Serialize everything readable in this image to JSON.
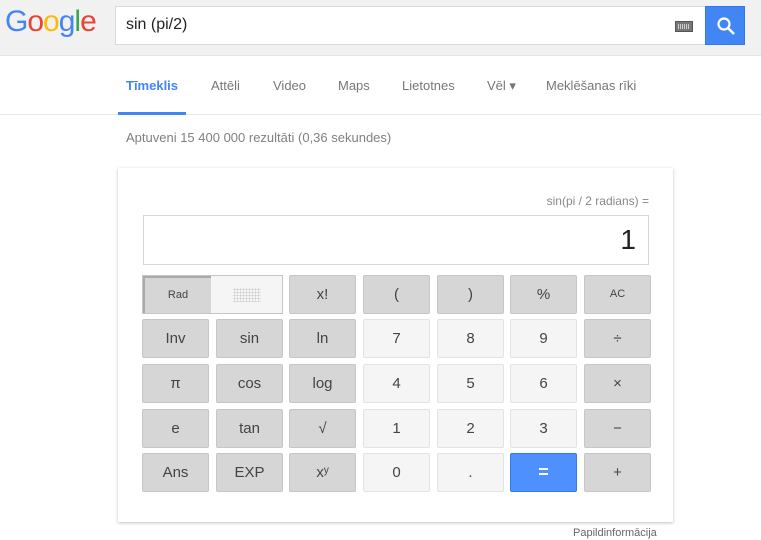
{
  "header": {
    "logo": "Google",
    "query": "sin (pi/2)",
    "keyboard_icon": "keyboard-icon",
    "search_icon": "search-icon",
    "accent": "#4285f4"
  },
  "nav": {
    "tabs": [
      {
        "label": "Tīmeklis",
        "active": true
      },
      {
        "label": "Attēli"
      },
      {
        "label": "Video"
      },
      {
        "label": "Maps"
      },
      {
        "label": "Lietotnes"
      },
      {
        "label": "Vēl ▾"
      },
      {
        "label": "Meklēšanas rīki"
      }
    ]
  },
  "stats": "Aptuveni 15 400 000 rezultāti (0,36 sekundes)",
  "calculator": {
    "expression": "sin(pi / 2 radians) =",
    "result": "1",
    "rad_label": "Rad",
    "keys": [
      [
        "",
        "",
        "x!",
        "(",
        ")",
        "%",
        "AC"
      ],
      [
        "Inv",
        "sin",
        "ln",
        "7",
        "8",
        "9",
        "÷"
      ],
      [
        "π",
        "cos",
        "log",
        "4",
        "5",
        "6",
        "×"
      ],
      [
        "e",
        "tan",
        "√",
        "1",
        "2",
        "3",
        "−"
      ],
      [
        "Ans",
        "EXP",
        "xʸ",
        "0",
        ".",
        "=",
        "+"
      ]
    ]
  },
  "footer": {
    "more_info": "Papildinformācija"
  }
}
